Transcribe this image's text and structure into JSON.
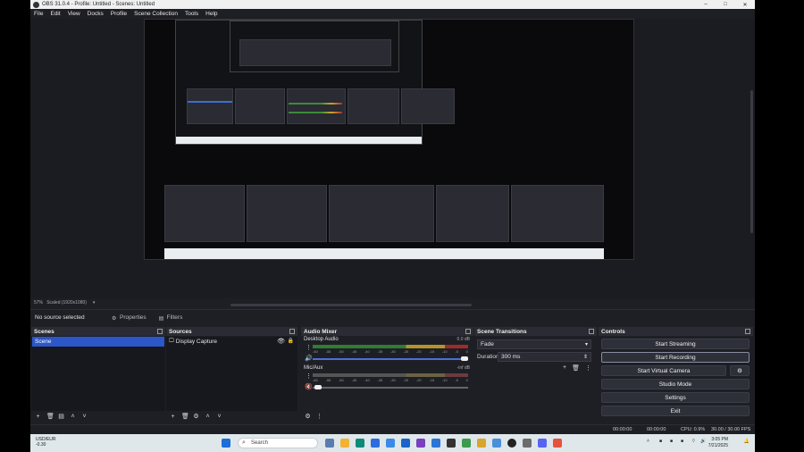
{
  "window": {
    "title": "OBS 31.0.4 - Profile: Untitled - Scenes: Untitled",
    "minimize": "–",
    "maximize": "□",
    "close": "✕"
  },
  "menu": [
    "File",
    "Edit",
    "View",
    "Docks",
    "Profile",
    "Scene Collection",
    "Tools",
    "Help"
  ],
  "preview": {
    "zoom": "57%",
    "scale": "Scaled (1920x1080)"
  },
  "context_bar": {
    "no_source": "No source selected",
    "properties": "Properties",
    "filters": "Filters"
  },
  "scenes": {
    "title": "Scenes",
    "items": [
      "Scene"
    ]
  },
  "sources": {
    "title": "Sources",
    "items": [
      {
        "name": "Display Capture"
      }
    ]
  },
  "mixer": {
    "title": "Audio Mixer",
    "channels": [
      {
        "name": "Desktop Audio",
        "db": "0.0 dB",
        "muted": false
      },
      {
        "name": "Mic/Aux",
        "db": "-inf dB",
        "muted": true
      }
    ],
    "ticks": [
      "-60",
      "-55",
      "-50",
      "-45",
      "-40",
      "-35",
      "-30",
      "-25",
      "-20",
      "-15",
      "-10",
      "-5",
      "0"
    ]
  },
  "transitions": {
    "title": "Scene Transitions",
    "type": "Fade",
    "duration_label": "Duration",
    "duration_value": "300 ms"
  },
  "controls": {
    "title": "Controls",
    "start_streaming": "Start Streaming",
    "start_recording": "Start Recording",
    "start_virtual_camera": "Start Virtual Camera",
    "studio_mode": "Studio Mode",
    "settings": "Settings",
    "exit": "Exit"
  },
  "status": {
    "stream_time": "00:00:00",
    "rec_time": "00:00:00",
    "cpu": "CPU: 0.9%",
    "fps": "30.00 / 30.00 FPS"
  },
  "taskbar": {
    "weather_temp": "USD/EUR",
    "weather_sub": "-0.30",
    "search": "Search",
    "time": "3:05 PM",
    "date": "7/21/2025"
  },
  "colors": {
    "accent": "#2c57c9",
    "bg": "#1e1f25",
    "panel": "#17181d"
  }
}
